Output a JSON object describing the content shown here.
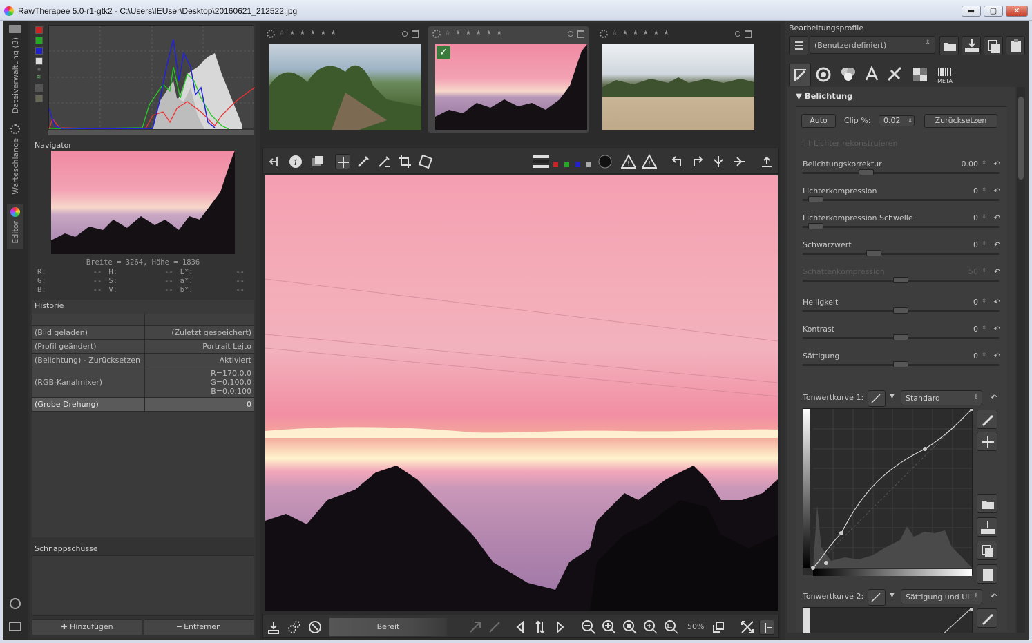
{
  "window": {
    "title": "RawTherapee 5.0-r1-gtk2 - C:\\Users\\IEUser\\Desktop\\20160621_212522.jpg",
    "minimize": "▬",
    "maximize": "▢",
    "close": "✕"
  },
  "vtabs": {
    "filebrowser": "Dateiverwaltung (3)",
    "queue": "Warteschlange",
    "editor": "Editor"
  },
  "navigator": {
    "title": "Navigator",
    "dims": "Breite = 3264, Höhe = 1836",
    "rows": [
      [
        {
          "k": "R:",
          "v": "--"
        },
        {
          "k": "H:",
          "v": "--"
        },
        {
          "k": "L*:",
          "v": "--"
        }
      ],
      [
        {
          "k": "G:",
          "v": "--"
        },
        {
          "k": "S:",
          "v": "--"
        },
        {
          "k": "a*:",
          "v": "--"
        }
      ],
      [
        {
          "k": "B:",
          "v": "--"
        },
        {
          "k": "V:",
          "v": "--"
        },
        {
          "k": "b*:",
          "v": "--"
        }
      ]
    ]
  },
  "history": {
    "title": "Historie",
    "rows": [
      {
        "action": "(Bild geladen)",
        "value": "(Zuletzt gespeichert)"
      },
      {
        "action": "(Profil geändert)",
        "value": "Portrait Lejto"
      },
      {
        "action": "(Belichtung) - Zurücksetzen",
        "value": "Aktiviert"
      },
      {
        "action": "(RGB-Kanalmixer)",
        "value_lines": [
          "R=170,0,0",
          "G=0,100,0",
          "B=0,0,100"
        ]
      },
      {
        "action": "(Grobe Drehung)",
        "value": "0"
      }
    ]
  },
  "snapshots": {
    "title": "Schnappschüsse",
    "add": "Hinzufügen",
    "remove": "Entfernen"
  },
  "bottombar": {
    "status": "Bereit",
    "zoom": "50%"
  },
  "right": {
    "profiles_title": "Bearbeitungsprofile",
    "profile_value": "(Benutzerdefiniert)",
    "section": "Belichtung",
    "auto": "Auto",
    "clip_label": "Clip %:",
    "clip_value": "0.02",
    "reset": "Zurücksetzen",
    "reconstruct": "Lichter rekonstruieren",
    "sliders": [
      {
        "label": "Belichtungskorrektur",
        "value": "0.00",
        "pos": 0.31,
        "dim": false
      },
      {
        "label": "Lichterkompression",
        "value": "0",
        "pos": 0.03,
        "dim": false
      },
      {
        "label": "Lichterkompression Schwelle",
        "value": "0",
        "pos": 0.03,
        "dim": false
      },
      {
        "label": "Schwarzwert",
        "value": "0",
        "pos": 0.35,
        "dim": false
      },
      {
        "label": "Schattenkompression",
        "value": "50",
        "pos": 0.5,
        "dim": true
      },
      {
        "label": "Helligkeit",
        "value": "0",
        "pos": 0.5,
        "dim": false
      },
      {
        "label": "Kontrast",
        "value": "0",
        "pos": 0.5,
        "dim": false
      },
      {
        "label": "Sättigung",
        "value": "0",
        "pos": 0.5,
        "dim": false
      }
    ],
    "curve1_label": "Tonwertkurve 1:",
    "curve1_mode": "Standard",
    "curve2_label": "Tonwertkurve 2:",
    "curve2_mode": "Sättigung und Ül"
  }
}
